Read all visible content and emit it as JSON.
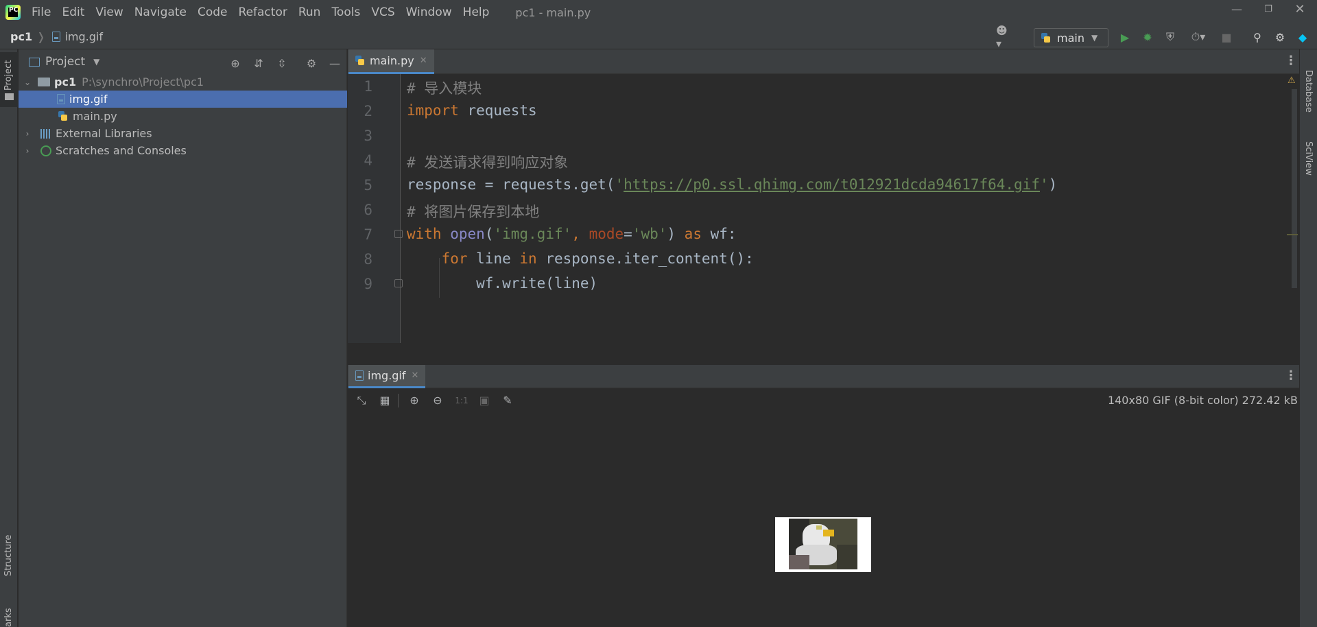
{
  "window": {
    "title": "pc1 - main.py",
    "logo_text": "PC"
  },
  "menu": [
    "File",
    "Edit",
    "View",
    "Navigate",
    "Code",
    "Refactor",
    "Run",
    "Tools",
    "VCS",
    "Window",
    "Help"
  ],
  "breadcrumb": {
    "project": "pc1",
    "file": "img.gif"
  },
  "toolbar": {
    "run_config": "main"
  },
  "project_panel": {
    "title": "Project",
    "tree": [
      {
        "label": "pc1",
        "hint": "P:\\synchro\\Project\\pc1",
        "type": "folder"
      },
      {
        "label": "img.gif",
        "type": "gif",
        "selected": true
      },
      {
        "label": "main.py",
        "type": "py"
      },
      {
        "label": "External Libraries",
        "type": "lib"
      },
      {
        "label": "Scratches and Consoles",
        "type": "scratch"
      }
    ]
  },
  "stripes": {
    "left_top": "Project",
    "left_bottom": "Structure",
    "left_bottom2": "arks",
    "right_top": "Database",
    "right_bottom": "SciView"
  },
  "editor": {
    "tab": "main.py",
    "line_numbers": [
      "1",
      "2",
      "3",
      "4",
      "5",
      "6",
      "7",
      "8",
      "9"
    ],
    "lines": [
      [
        {
          "t": "# 导入模块",
          "c": "cm"
        }
      ],
      [
        {
          "t": "import",
          "c": "kw"
        },
        {
          "t": " requests",
          "c": ""
        }
      ],
      [],
      [
        {
          "t": "# 发送请求得到响应对象",
          "c": "cm"
        }
      ],
      [
        {
          "t": "response = requests.get(",
          "c": ""
        },
        {
          "t": "'",
          "c": "st"
        },
        {
          "t": "https://p0.ssl.qhimg.com/t012921dcda94617f64.gif",
          "c": "url"
        },
        {
          "t": "'",
          "c": "st"
        },
        {
          "t": ")",
          "c": ""
        }
      ],
      [
        {
          "t": "# 将图片保存到本地",
          "c": "cm"
        }
      ],
      [
        {
          "t": "with",
          "c": "kw"
        },
        {
          "t": " ",
          "c": ""
        },
        {
          "t": "open",
          "c": "bi"
        },
        {
          "t": "(",
          "c": ""
        },
        {
          "t": "'img.gif'",
          "c": "st"
        },
        {
          "t": ", ",
          "c": "kw"
        },
        {
          "t": "mode",
          "c": "pr"
        },
        {
          "t": "=",
          "c": ""
        },
        {
          "t": "'wb'",
          "c": "st"
        },
        {
          "t": ") ",
          "c": ""
        },
        {
          "t": "as",
          "c": "kw"
        },
        {
          "t": " wf:",
          "c": ""
        }
      ],
      [
        {
          "t": "    ",
          "c": ""
        },
        {
          "t": "for",
          "c": "kw"
        },
        {
          "t": " line ",
          "c": ""
        },
        {
          "t": "in",
          "c": "kw"
        },
        {
          "t": " response.iter_content():",
          "c": ""
        }
      ],
      [
        {
          "t": "        wf.write(line)",
          "c": ""
        }
      ]
    ]
  },
  "image_viewer": {
    "tab": "img.gif",
    "info": "140x80 GIF (8-bit color) 272.42 kB",
    "zoom_label": "1:1"
  }
}
